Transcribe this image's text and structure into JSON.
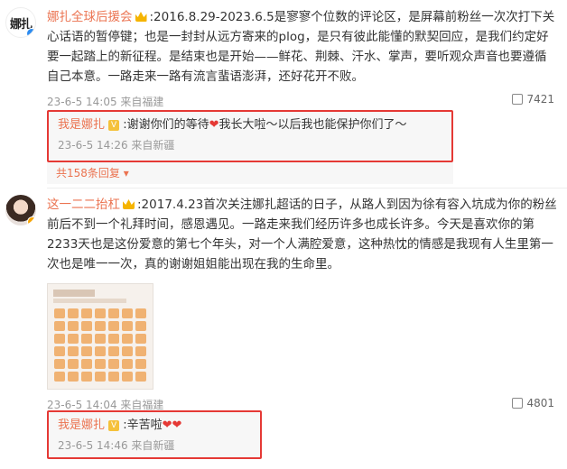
{
  "comments": [
    {
      "avatar_text": "娜扎",
      "username": "娜扎全球后援会",
      "text": ":2016.8.29-2023.6.5是寥寥个位数的评论区，是屏幕前粉丝一次次打下关心话语的暂停键；也是一封封从远方寄来的plog，是只有彼此能懂的默契回应，是我们约定好要一起踏上的新征程。是结束也是开始——鲜花、荆棘、汗水、掌声，要听观众声音也要遵循自己本意。一路走来一路有流言蜚语澎湃，还好花开不败。",
      "meta": "23-6-5 14:05 来自福建",
      "likes": "7421",
      "reply": {
        "name": "我是娜扎",
        "badge": "V",
        "text_before": ":谢谢你们的等待",
        "heart": "❤",
        "text_after": "我长大啦～以后我也能保护你们了～",
        "meta": "23-6-5 14:26 来自新疆"
      },
      "more_replies": "共158条回复 ▾"
    },
    {
      "username": "这一二二抬杠",
      "text": ":2017.4.23首次关注娜扎超话的日子，从路人到因为徐有容入坑成为你的粉丝前后不到一个礼拜时间，感恩遇见。一路走来我们经历许多也成长许多。今天是喜欢你的第2233天也是这份爱意的第七个年头，对一个人满腔爱意，这种热忱的情感是我现有人生里第一次也是唯一一次，真的谢谢姐姐能出现在我的生命里。",
      "meta": "23-6-5 14:04 来自福建",
      "likes": "4801",
      "reply": {
        "name": "我是娜扎",
        "badge": "V",
        "text_before": ":辛苦啦",
        "heart": "❤❤",
        "meta": "23-6-5 14:46 来自新疆"
      }
    }
  ]
}
